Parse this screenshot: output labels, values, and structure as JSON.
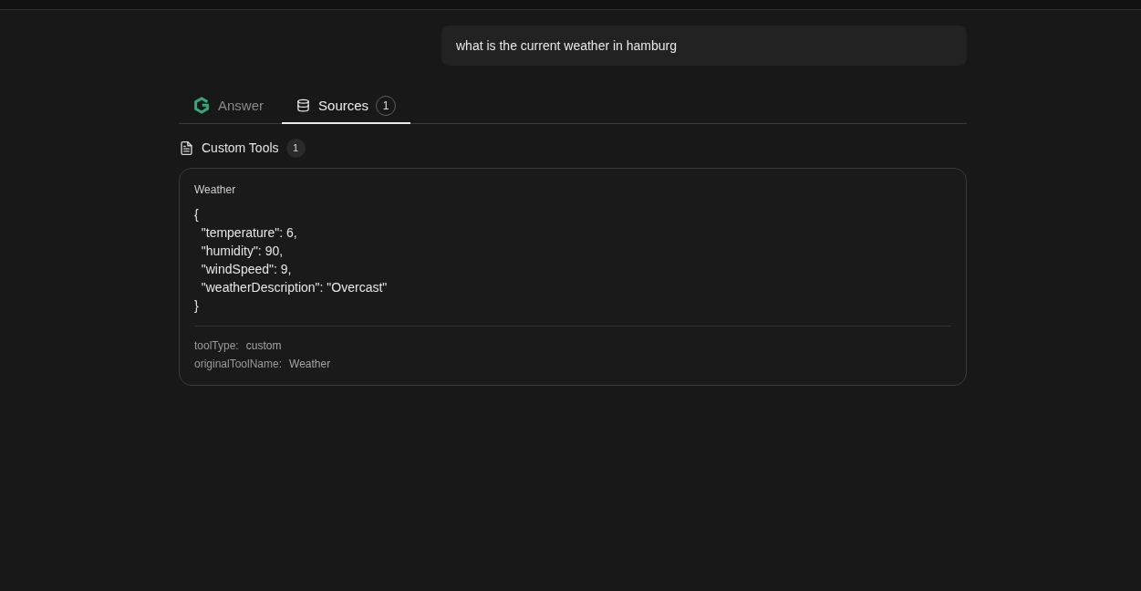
{
  "user_message": {
    "text": "what is the current weather in hamburg"
  },
  "tabs": [
    {
      "kind": "answer",
      "label": "Answer",
      "selected": false
    },
    {
      "kind": "sources",
      "label": "Sources",
      "count": "1",
      "selected": true
    }
  ],
  "source_groups": [
    {
      "title": "Custom Tools",
      "count": "1",
      "results": [
        {
          "title": "Weather",
          "content": "{\n  \"temperature\": 6,\n  \"humidity\": 90,\n  \"windSpeed\": 9,\n  \"weatherDescription\": \"Overcast\"\n}",
          "metadata": [
            {
              "key": "toolType:",
              "value": "custom"
            },
            {
              "key": "originalToolName:",
              "value": "Weather"
            }
          ]
        }
      ]
    }
  ]
}
